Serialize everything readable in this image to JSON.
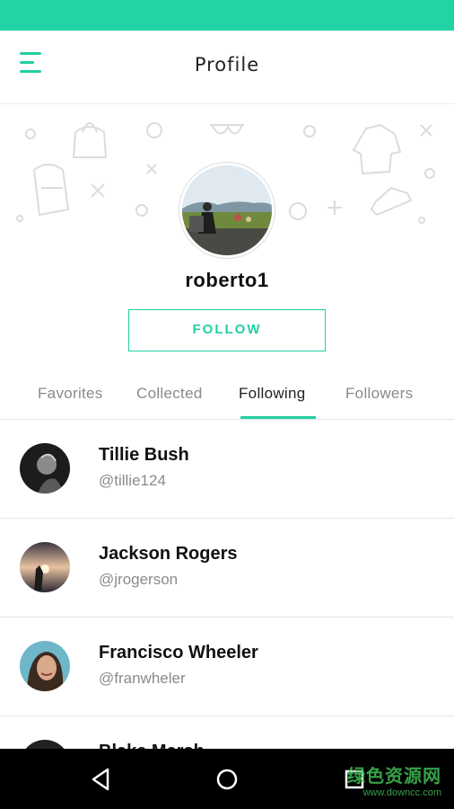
{
  "app_bar": {
    "title": "Profile",
    "menu_icon": "hamburger-menu-icon"
  },
  "profile": {
    "username": "roberto1",
    "follow_label": "FOLLOW"
  },
  "tabs": [
    {
      "label": "Favorites",
      "active": false
    },
    {
      "label": "Collected",
      "active": false
    },
    {
      "label": "Following",
      "active": true
    },
    {
      "label": "Followers",
      "active": false
    }
  ],
  "following": [
    {
      "name": "Tillie Bush",
      "handle": "@tillie124"
    },
    {
      "name": "Jackson Rogers",
      "handle": "@jrogerson"
    },
    {
      "name": "Francisco Wheeler",
      "handle": "@franwheler"
    },
    {
      "name": "Blake Marsh",
      "handle": ""
    }
  ],
  "nav": {
    "back_icon": "back-triangle-icon",
    "home_icon": "home-circle-icon",
    "recents_icon": "recents-square-icon"
  },
  "watermark": {
    "line1": "绿色资源网",
    "line2": "www.downcc.com"
  },
  "colors": {
    "accent": "#22cfa3",
    "status_bar": "#22d3a6"
  }
}
